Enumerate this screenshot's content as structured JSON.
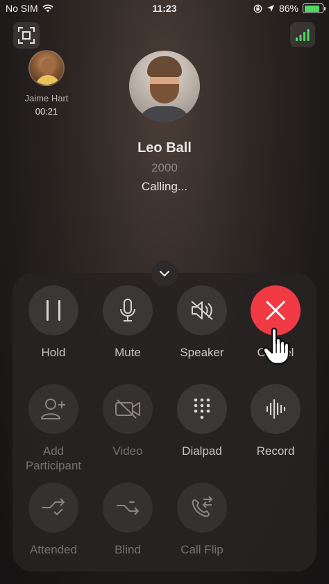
{
  "status_bar": {
    "carrier": "No SIM",
    "time": "11:23",
    "battery_percent_text": "86%",
    "battery_level": 0.86,
    "icons": [
      "wifi-icon",
      "orientation-lock-icon",
      "location-arrow-icon",
      "battery-icon"
    ]
  },
  "top_controls": {
    "minimize_icon": "minimize-frame-icon",
    "signal_icon": "signal-bars-icon",
    "signal_color": "#4cd964"
  },
  "held_call": {
    "name": "Jaime Hart",
    "duration": "00:21"
  },
  "caller": {
    "name": "Leo Ball",
    "extension": "2000",
    "status": "Calling..."
  },
  "controls": {
    "collapse_icon": "chevron-down-icon",
    "hold": {
      "label": "Hold",
      "icon": "pause-icon"
    },
    "mute": {
      "label": "Mute",
      "icon": "microphone-icon"
    },
    "speaker": {
      "label": "Speaker",
      "icon": "speaker-muted-icon"
    },
    "end": {
      "label": "Cancel",
      "icon": "close-icon",
      "color": "#f23a44"
    },
    "add_participant": {
      "label_line1": "Add",
      "label_line2": "Participant",
      "icon": "add-person-icon",
      "enabled": false
    },
    "video": {
      "label": "Video",
      "icon": "video-off-icon",
      "enabled": false
    },
    "dialpad": {
      "label": "Dialpad",
      "icon": "dialpad-icon"
    },
    "record": {
      "label": "Record",
      "icon": "waveform-icon"
    },
    "attended": {
      "label": "Attended",
      "icon": "attended-transfer-icon",
      "enabled": false
    },
    "blind": {
      "label": "Blind",
      "icon": "blind-transfer-icon",
      "enabled": false
    },
    "call_flip": {
      "label": "Call Flip",
      "icon": "call-flip-icon",
      "enabled": false
    }
  }
}
